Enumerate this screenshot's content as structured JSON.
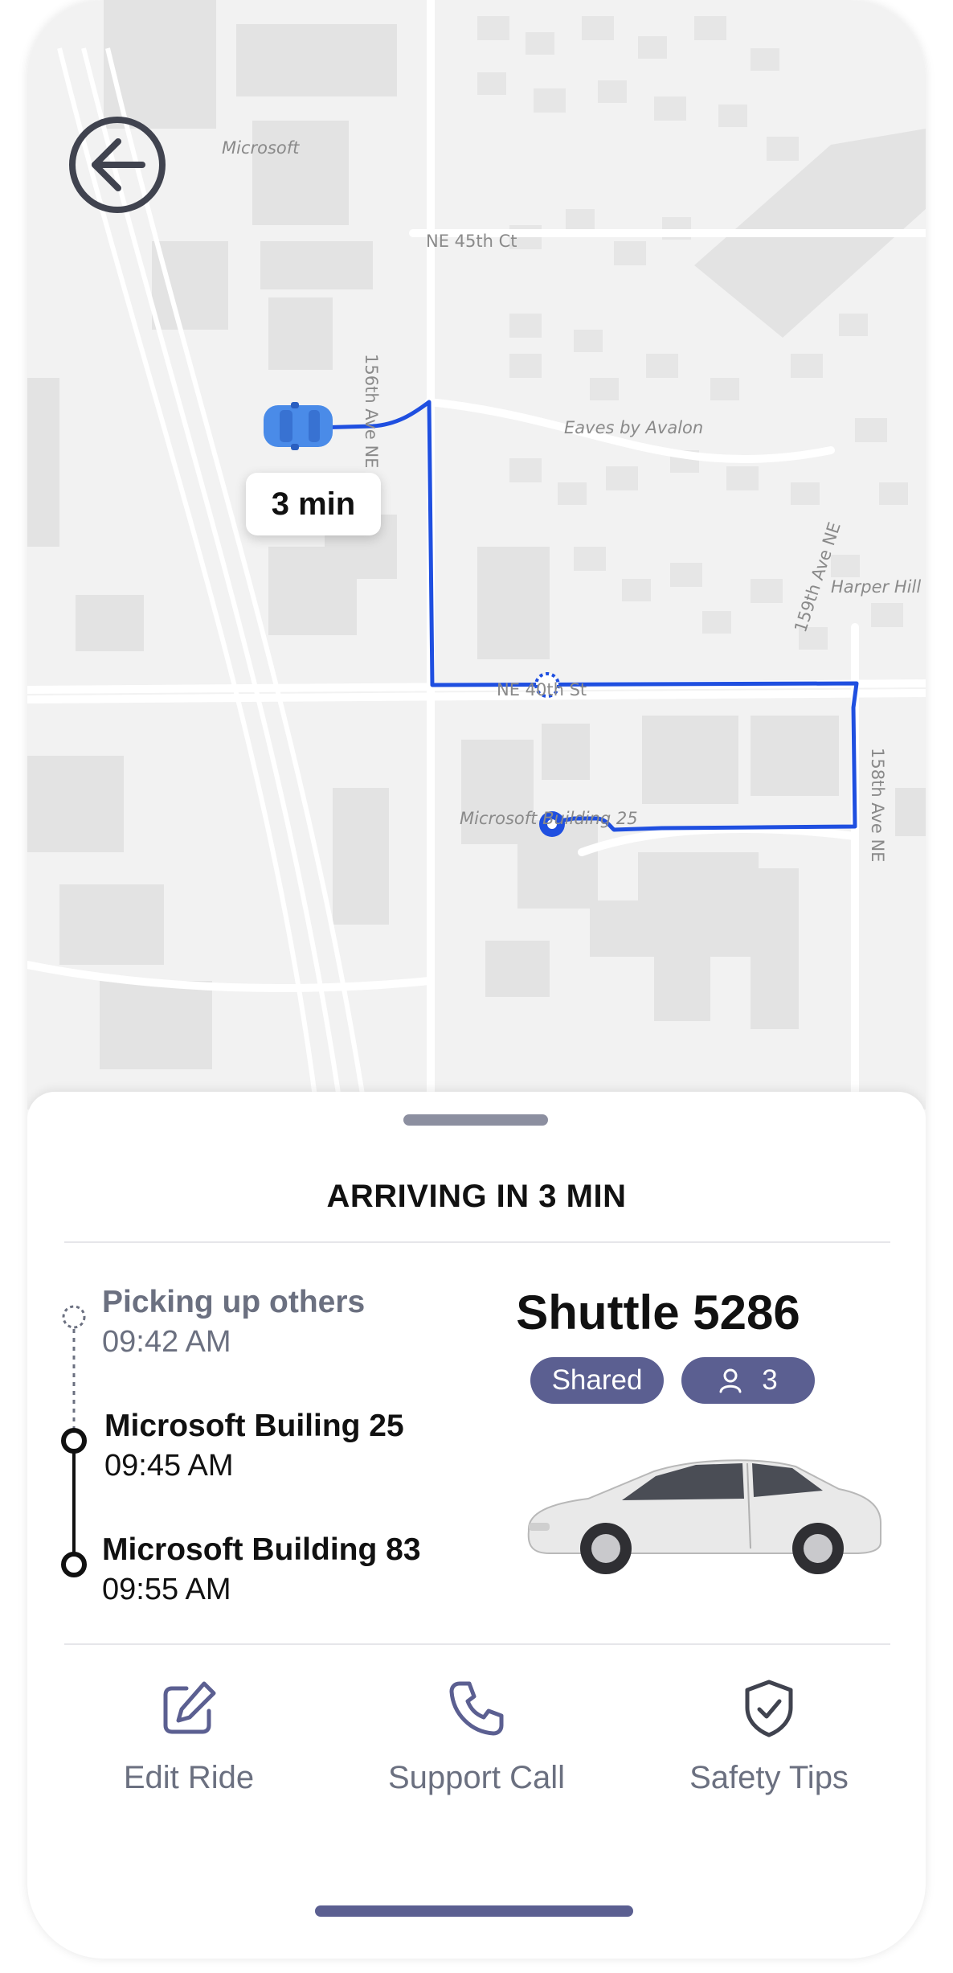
{
  "map": {
    "labels": {
      "microsoft": "Microsoft",
      "ne_45th_ct": "NE 45th Ct",
      "ave_156th": "156th Ave NE",
      "eaves": "Eaves by Avalon",
      "ave_159th": "159th Ave NE",
      "harper_hill": "Harper Hill",
      "ne_40th_st": "NE 40th St",
      "building_25": "Microsoft Building 25",
      "ave_158th": "158th Ave NE"
    },
    "eta_label": "3 min",
    "route_color": "#1f4fe0",
    "car_color": "#4a8be8"
  },
  "sheet": {
    "status_title": "ARRIVING IN 3 MIN",
    "stops": [
      {
        "name": "Picking up others",
        "time": "09:42 AM",
        "state": "pending"
      },
      {
        "name": "Microsoft Builing 25",
        "time": "09:45 AM",
        "state": "pickup"
      },
      {
        "name": "Microsoft Building 83",
        "time": "09:55 AM",
        "state": "dropoff"
      }
    ],
    "vehicle": {
      "name": "Shuttle 5286",
      "type_badge": "Shared",
      "passenger_count": "3"
    },
    "actions": [
      {
        "label": "Edit Ride",
        "icon": "edit-icon"
      },
      {
        "label": "Support Call",
        "icon": "phone-icon"
      },
      {
        "label": "Safety Tips",
        "icon": "shield-check-icon"
      }
    ]
  },
  "colors": {
    "accent": "#5b5f91",
    "route": "#1f4fe0",
    "muted_text": "#6b7080"
  }
}
